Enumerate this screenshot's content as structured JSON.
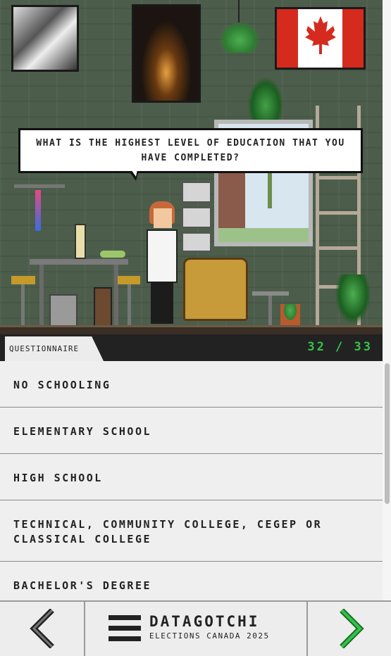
{
  "scene": {
    "question": "What is the highest level of education that you have completed?"
  },
  "status": {
    "tab_label": "Questionnaire",
    "progress": "32 / 33"
  },
  "options": [
    {
      "label": "No schooling"
    },
    {
      "label": "Elementary school"
    },
    {
      "label": "High school"
    },
    {
      "label": "Technical, community college, CEGEP or Classical college"
    },
    {
      "label": "Bachelor's degree"
    }
  ],
  "nav": {
    "prev_icon": "chevron-left-icon",
    "next_icon": "chevron-right-icon",
    "menu_icon": "hamburger-menu-icon",
    "title": "Datagotchi",
    "subtitle": "Elections Canada 2025"
  },
  "colors": {
    "accent_green": "#35c24a",
    "wall": "#4c5e4b",
    "flag_red": "#d52b1e"
  }
}
